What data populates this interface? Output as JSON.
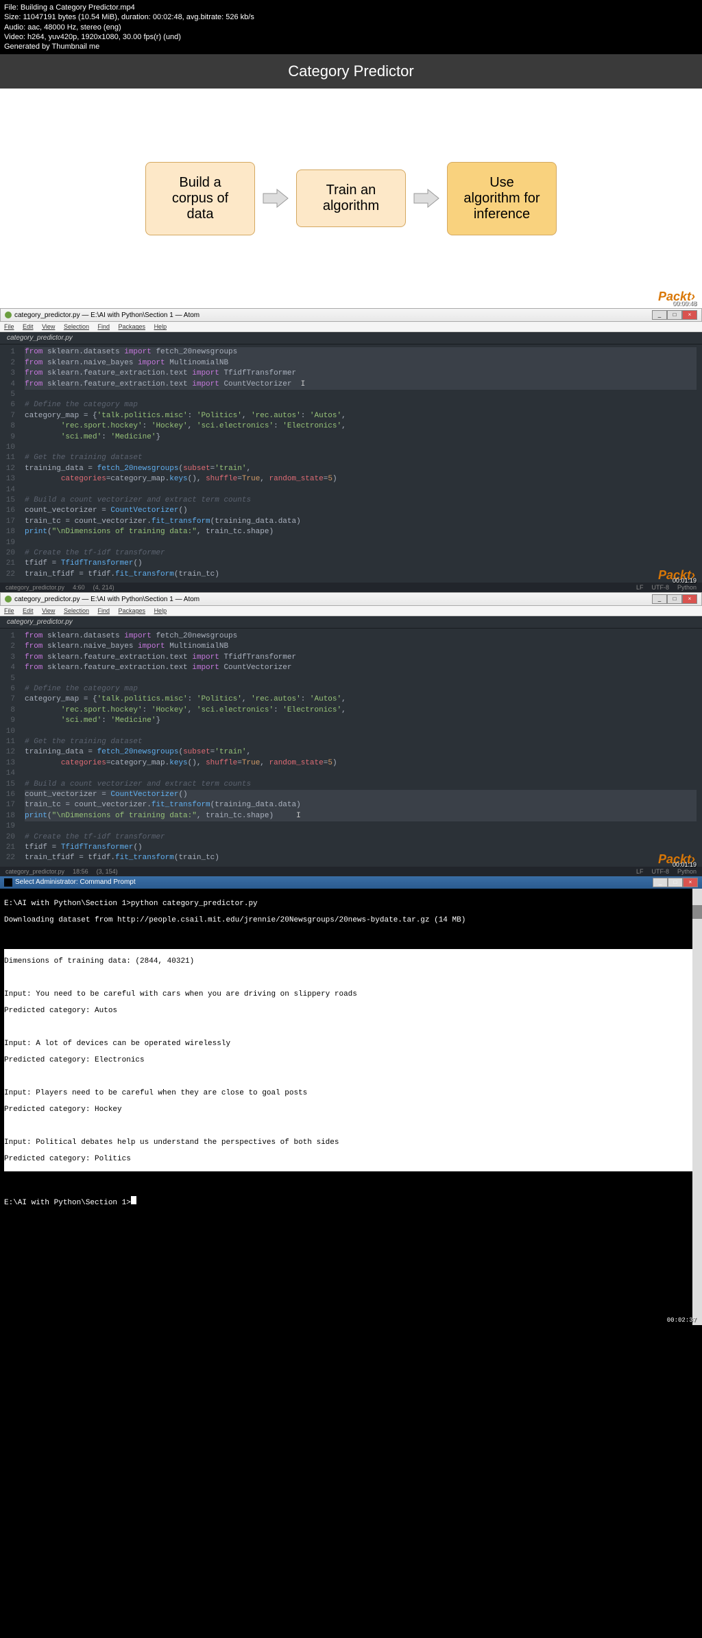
{
  "meta": {
    "file": "File: Building a Category Predictor.mp4",
    "size": "Size: 11047191 bytes (10.54 MiB), duration: 00:02:48, avg.bitrate: 526 kb/s",
    "audio": "Audio: aac, 48000 Hz, stereo (eng)",
    "video": "Video: h264, yuv420p, 1920x1080, 30.00 fps(r) (und)",
    "gen": "Generated by Thumbnail me"
  },
  "title": "Category Predictor",
  "boxes": {
    "b1": "Build a corpus of data",
    "b2": "Train an algorithm",
    "b3": "Use algorithm for inference"
  },
  "packt": "Packt›",
  "ts1": "00:00:48",
  "ts2": "00:01:19",
  "ts3": "00:01:19",
  "ts4": "00:02:37",
  "atom": {
    "title": "category_predictor.py — E:\\AI with Python\\Section 1 — Atom",
    "menu": {
      "file": "File",
      "edit": "Edit",
      "view": "View",
      "sel": "Selection",
      "find": "Find",
      "pkg": "Packages",
      "help": "Help"
    },
    "tab": "category_predictor.py",
    "status1": {
      "file": "category_predictor.py",
      "pos": "4:60",
      "sel": "(4, 214)",
      "lf": "LF",
      "enc": "UTF-8",
      "lang": "Python"
    },
    "status2": {
      "file": "category_predictor.py",
      "pos": "18:56",
      "sel": "(3, 154)",
      "lf": "LF",
      "enc": "UTF-8",
      "lang": "Python"
    }
  },
  "cmd": {
    "title": "Select Administrator: Command Prompt",
    "line1": "E:\\AI with Python\\Section 1>python category_predictor.py",
    "line2": "Downloading dataset from http://people.csail.mit.edu/jrennie/20Newsgroups/20news-bydate.tar.gz (14 MB)",
    "out1": "Dimensions of training data: (2844, 40321)",
    "out2": "Input: You need to be careful with cars when you are driving on slippery roads",
    "out3": "Predicted category: Autos",
    "out4": "Input: A lot of devices can be operated wirelessly",
    "out5": "Predicted category: Electronics",
    "out6": "Input: Players need to be careful when they are close to goal posts",
    "out7": "Predicted category: Hockey",
    "out8": "Input: Political debates help us understand the perspectives of both sides",
    "out9": "Predicted category: Politics",
    "prompt": "E:\\AI with Python\\Section 1>"
  }
}
